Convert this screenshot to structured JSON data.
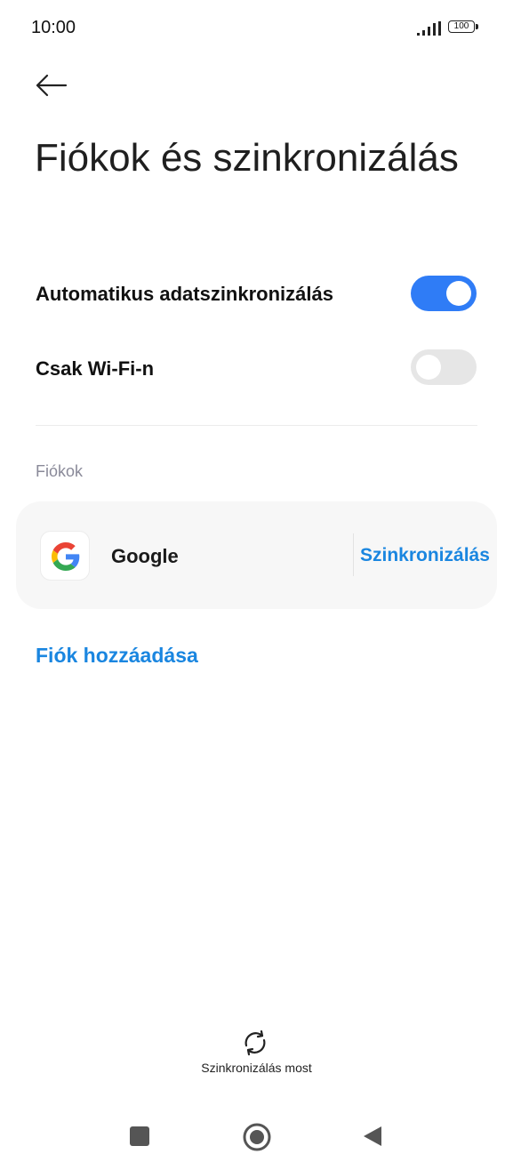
{
  "status_bar": {
    "time": "10:00",
    "battery": "100",
    "icons": [
      "signal-icon",
      "battery-icon"
    ]
  },
  "header": {
    "back_icon": "arrow-left-icon",
    "title": "Fiókok és szinkronizálás"
  },
  "settings": {
    "auto_sync": {
      "label": "Automatikus adatszinkronizálás",
      "enabled": true
    },
    "wifi_only": {
      "label": "Csak Wi-Fi-n",
      "enabled": false
    }
  },
  "accounts": {
    "section_label": "Fiókok",
    "items": [
      {
        "name": "Google",
        "icon": "google-logo-icon",
        "action": "Szinkronizálás"
      }
    ],
    "add_label": "Fiók hozzáadása"
  },
  "footer": {
    "sync_now_label": "Szinkronizálás most",
    "sync_icon": "sync-icon"
  },
  "nav_bar": {
    "icons": [
      "recents-icon",
      "home-icon",
      "back-icon"
    ]
  },
  "colors": {
    "accent": "#2f7cf6",
    "link": "#1a86e0",
    "toggle_off": "#e6e6e6",
    "card_bg": "#f7f7f7"
  }
}
